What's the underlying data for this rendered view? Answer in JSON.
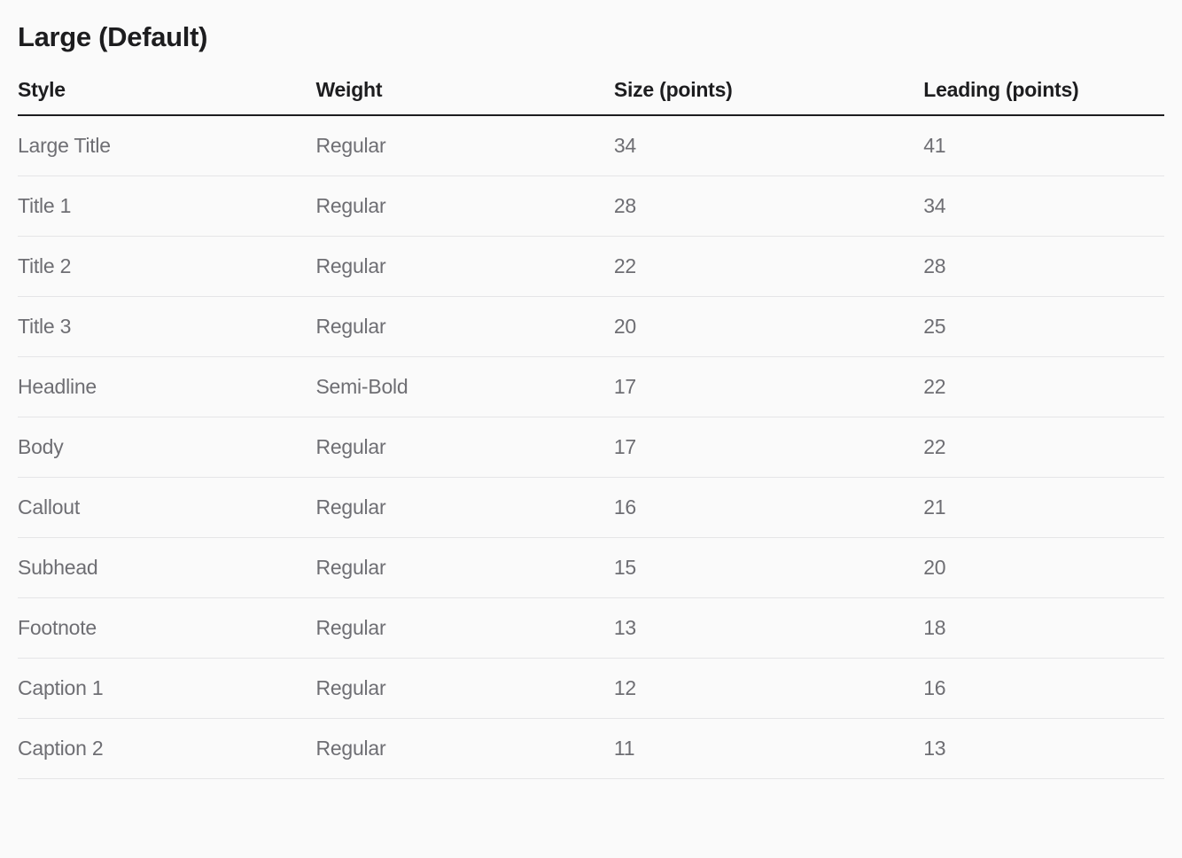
{
  "title": "Large (Default)",
  "headers": {
    "style": "Style",
    "weight": "Weight",
    "size": "Size (points)",
    "leading": "Leading (points)"
  },
  "rows": [
    {
      "style": "Large Title",
      "weight": "Regular",
      "size": "34",
      "leading": "41"
    },
    {
      "style": "Title 1",
      "weight": "Regular",
      "size": "28",
      "leading": "34"
    },
    {
      "style": "Title 2",
      "weight": "Regular",
      "size": "22",
      "leading": "28"
    },
    {
      "style": "Title 3",
      "weight": "Regular",
      "size": "20",
      "leading": "25"
    },
    {
      "style": "Headline",
      "weight": "Semi-Bold",
      "size": "17",
      "leading": "22"
    },
    {
      "style": "Body",
      "weight": "Regular",
      "size": "17",
      "leading": "22"
    },
    {
      "style": "Callout",
      "weight": "Regular",
      "size": "16",
      "leading": "21"
    },
    {
      "style": "Subhead",
      "weight": "Regular",
      "size": "15",
      "leading": "20"
    },
    {
      "style": "Footnote",
      "weight": "Regular",
      "size": "13",
      "leading": "18"
    },
    {
      "style": "Caption 1",
      "weight": "Regular",
      "size": "12",
      "leading": "16"
    },
    {
      "style": "Caption 2",
      "weight": "Regular",
      "size": "11",
      "leading": "13"
    }
  ]
}
